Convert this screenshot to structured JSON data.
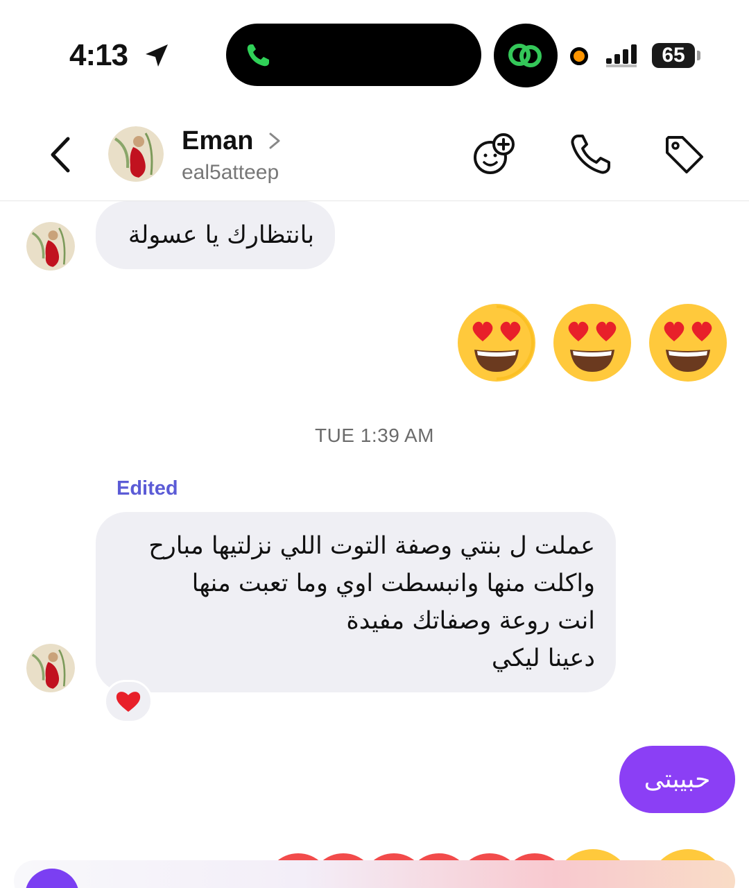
{
  "status_bar": {
    "time": "4:13",
    "battery": "65"
  },
  "header": {
    "name": "Eman",
    "username": "eal5atteep"
  },
  "messages": {
    "incoming_1": "بانتظارك يا عسولة",
    "timestamp": "TUE 1:39 AM",
    "edited_label": "Edited",
    "incoming_2": "عملت ل بنتي وصفة التوت اللي نزلتيها مبارح\nواكلت منها وانبسطت اوي وما تعبت منها\nانت روعة وصفاتك مفيدة\nدعينا ليكي",
    "reaction": "❤️",
    "outgoing_1": "حبيبتى"
  },
  "colors": {
    "accent": "#8b3ff5",
    "edited": "#5b5bd6",
    "bubble": "#efeff4"
  },
  "icons": [
    "back-icon",
    "chevron-right-icon",
    "add-friend-emoji-icon",
    "phone-icon",
    "tag-icon",
    "location-arrow-icon",
    "camera-icon"
  ]
}
